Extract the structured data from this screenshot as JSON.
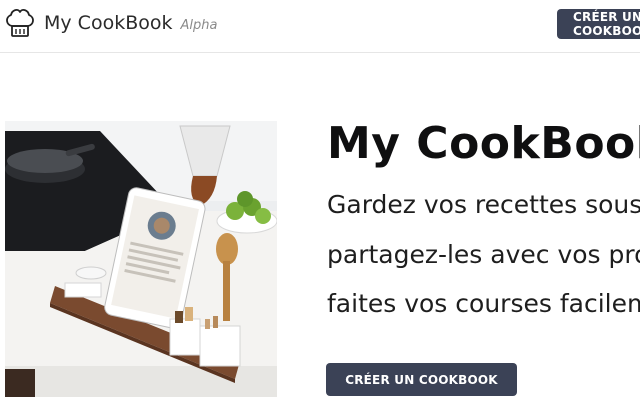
{
  "header": {
    "brand": "My CookBook",
    "brand_tag": "Alpha",
    "cta_label": "CRÉER UN COOKBOOK"
  },
  "hero": {
    "title": "My CookBook",
    "lines": [
      "Gardez vos recettes sous la main,",
      "partagez-les avec vos proches et",
      "faites vos courses facilement"
    ],
    "cta_label": "CRÉER UN COOKBOOK"
  },
  "icons": {
    "logo": "chef-hat-icon"
  },
  "colors": {
    "button_bg": "#3b4256",
    "button_text": "#ffffff",
    "title": "#0f0f10"
  }
}
